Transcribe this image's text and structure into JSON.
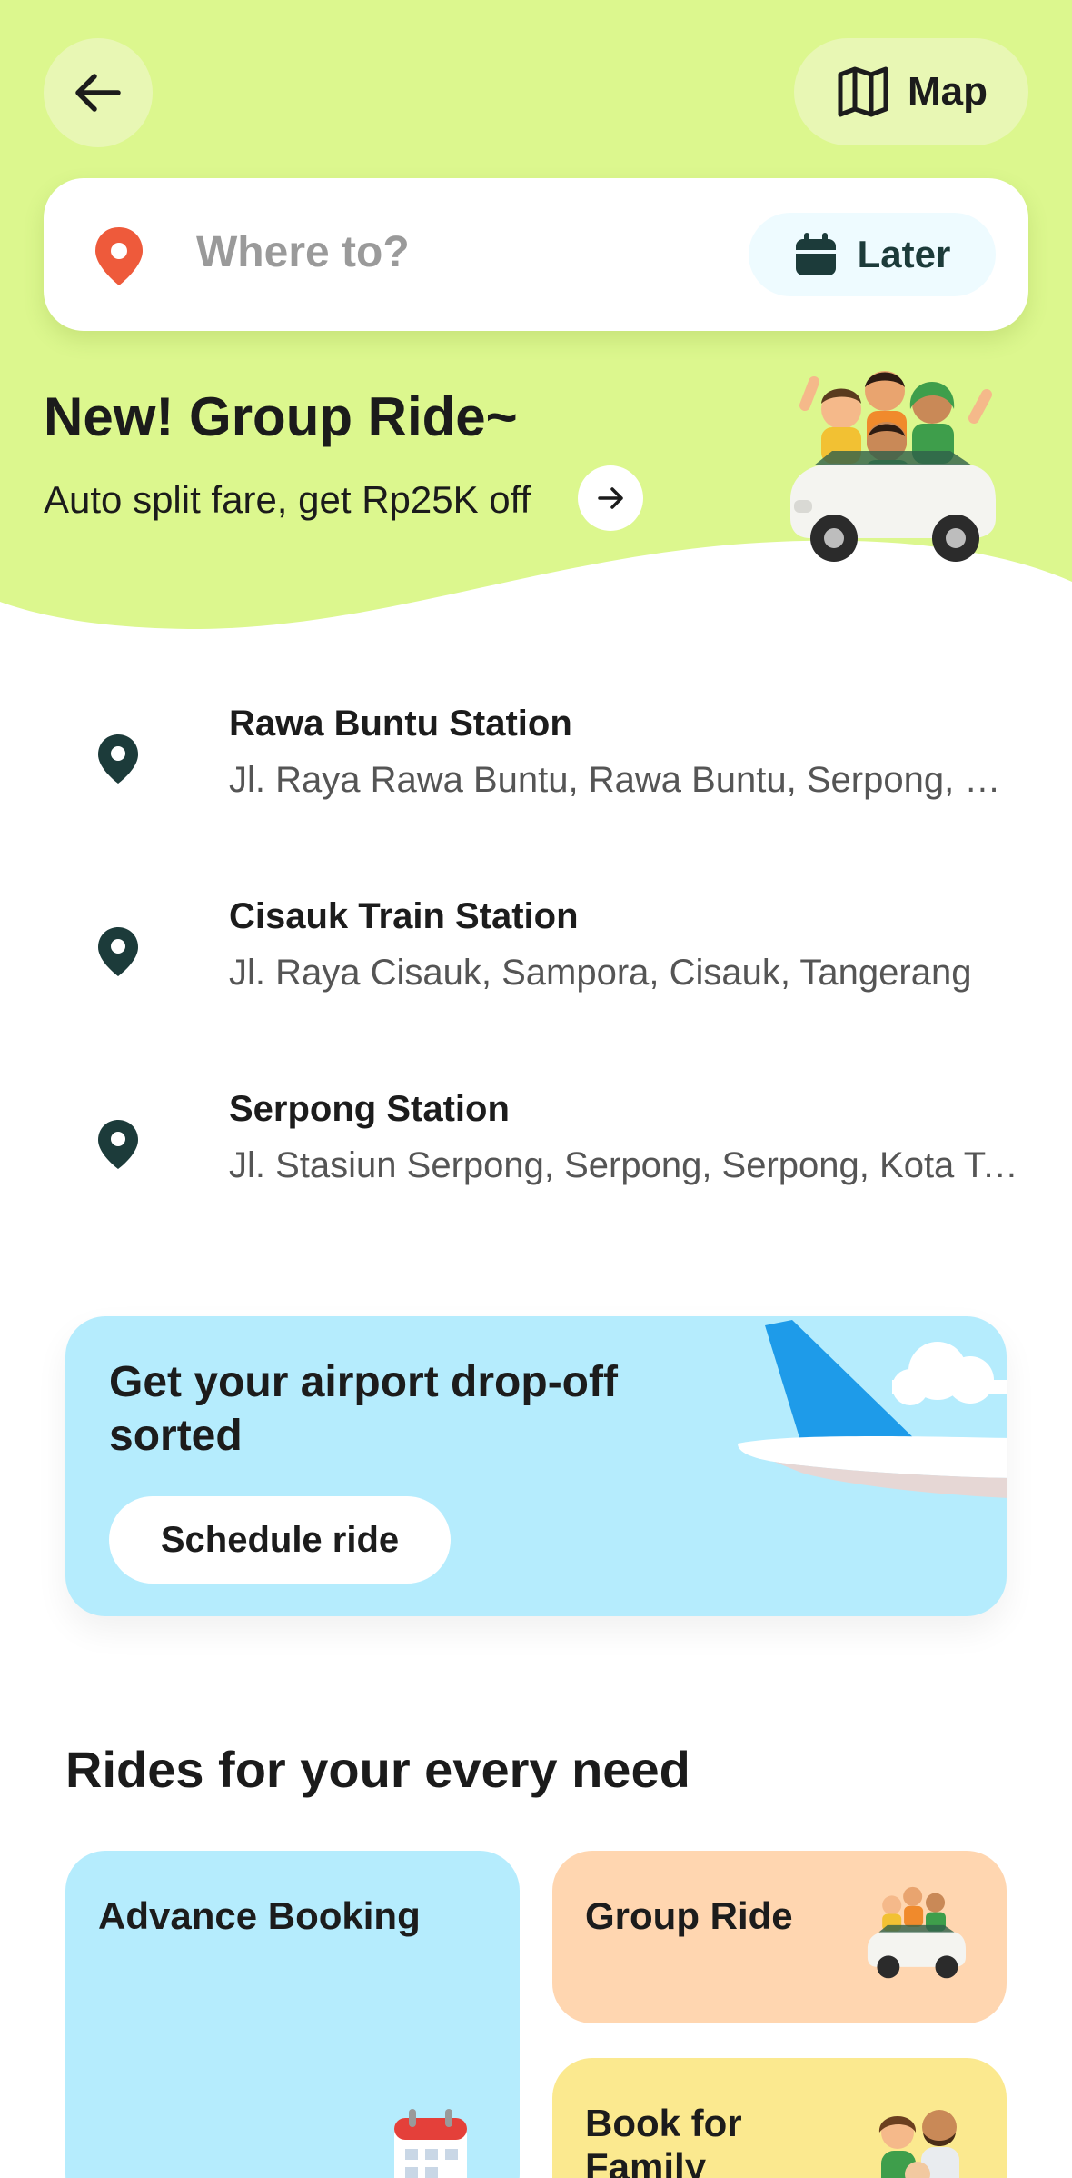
{
  "header": {
    "back_icon": "arrow-left-icon",
    "map_label": "Map",
    "map_icon": "map-icon"
  },
  "search": {
    "placeholder": "Where to?",
    "pin_icon": "location-pin-icon",
    "later_label": "Later",
    "later_icon": "calendar-icon"
  },
  "promo": {
    "title": "New! Group Ride~",
    "subtitle": "Auto split fare, get Rp25K off",
    "arrow_icon": "arrow-right-icon"
  },
  "recent_places": [
    {
      "name": "Rawa Buntu Station",
      "address": "Jl. Raya Rawa Buntu, Rawa Buntu, Serpong, Kota Tangerang Selatan"
    },
    {
      "name": "Cisauk Train Station",
      "address": "Jl. Raya Cisauk, Sampora, Cisauk, Tangerang"
    },
    {
      "name": "Serpong Station",
      "address": "Jl. Stasiun Serpong, Serpong, Serpong, Kota Tangerang Selatan"
    }
  ],
  "airport_banner": {
    "title": "Get your airport drop-off sorted",
    "button_label": "Schedule ride"
  },
  "rides_section": {
    "title": "Rides for your every need",
    "cards": [
      {
        "label": "Advance Booking"
      },
      {
        "label": "Group Ride"
      },
      {
        "label": "Book for Family"
      }
    ]
  },
  "colors": {
    "hero_green": "#dcf78e",
    "pin_dark": "#1c3b3a",
    "pin_red": "#ee5a3b",
    "airport_bg": "#b5ecfd",
    "group_bg": "#ffd6b0",
    "family_bg": "#fbe98f"
  }
}
